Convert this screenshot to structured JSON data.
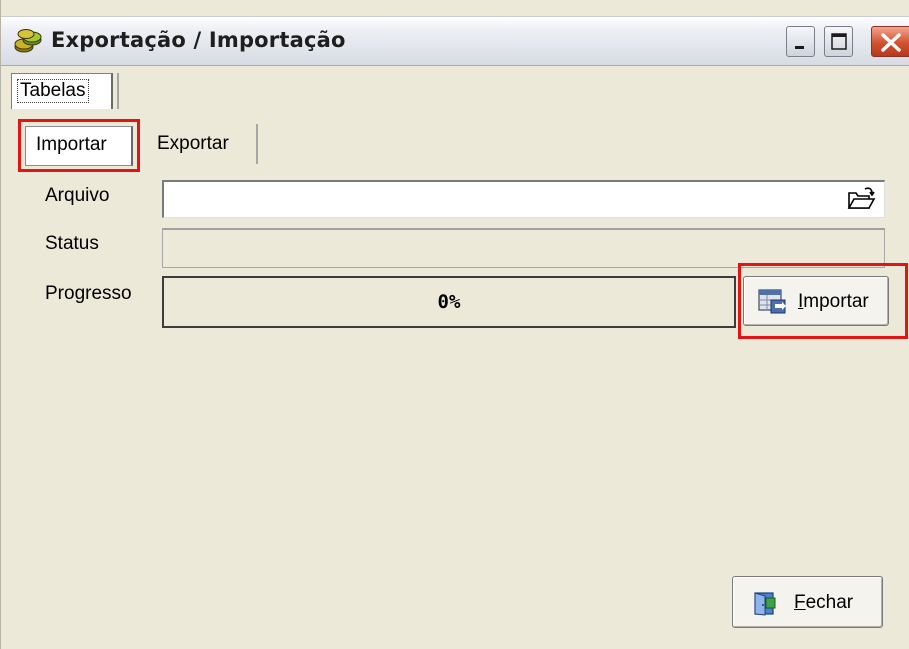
{
  "window": {
    "title": "Exportação / Importação",
    "icon": "coins-app-icon",
    "controls": [
      "minimize-icon",
      "maximize-icon",
      "close-icon"
    ]
  },
  "outer_tabs": [
    {
      "label": "Tabelas",
      "active": true
    }
  ],
  "inner_tabs": [
    {
      "label": "Importar",
      "active": true,
      "highlighted": true
    },
    {
      "label": "Exportar",
      "active": false
    }
  ],
  "form": {
    "arquivo": {
      "label": "Arquivo",
      "value": "",
      "browse_icon": "open-folder-icon"
    },
    "status": {
      "label": "Status",
      "value": ""
    },
    "progresso": {
      "label": "Progresso",
      "value_text": "0%",
      "fraction": 0
    }
  },
  "buttons": {
    "importar": {
      "accel": "I",
      "rest": "mportar",
      "icon": "import-table-icon",
      "highlighted": true
    },
    "fechar": {
      "accel": "F",
      "rest": "echar",
      "icon": "exit-door-icon"
    }
  },
  "colors": {
    "window_bg": "#ece9d8",
    "highlight": "#e31414",
    "close_button": "#d1522f",
    "progress_fill": "#3169c6"
  }
}
